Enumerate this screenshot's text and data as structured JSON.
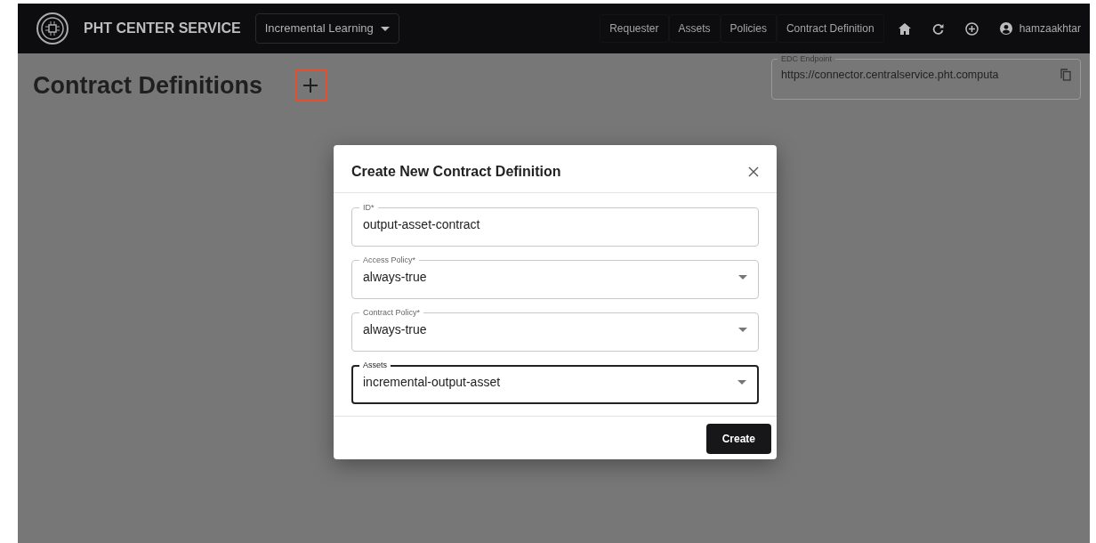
{
  "navbar": {
    "brand": "PHT CENTER SERVICE",
    "project_dropdown": "Incremental Learning",
    "links": [
      "Requester",
      "Assets",
      "Policies",
      "Contract Definition"
    ],
    "user": "hamzaakhtar"
  },
  "page": {
    "title": "Contract Definitions",
    "add_highlighted": true
  },
  "edc_endpoint": {
    "label": "EDC Endpoint",
    "value": "https://connector.centralservice.pht.computa"
  },
  "modal": {
    "title": "Create New Contract Definition",
    "fields": [
      {
        "label": "ID*",
        "kind": "text",
        "value": "output-asset-contract",
        "focused": false
      },
      {
        "label": "Access Policy*",
        "kind": "select",
        "value": "always-true",
        "focused": false
      },
      {
        "label": "Contract Policy*",
        "kind": "select",
        "value": "always-true",
        "focused": false
      },
      {
        "label": "Assets",
        "kind": "select",
        "value": "incremental-output-asset",
        "focused": true
      }
    ],
    "submit": "Create"
  }
}
